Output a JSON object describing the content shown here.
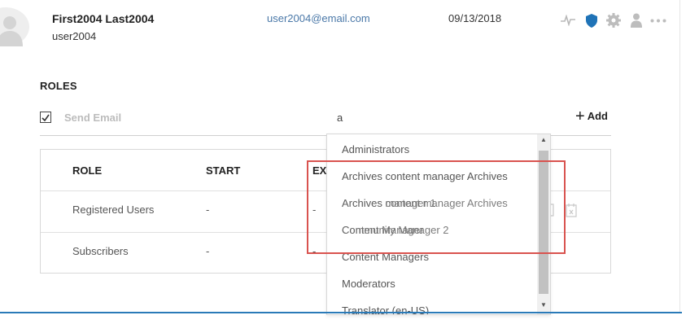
{
  "user": {
    "full_name": "First2004 Last2004",
    "username": "user2004",
    "email": "user2004@email.com",
    "date": "09/13/2018"
  },
  "header_icons": [
    "activity-icon",
    "shield-icon",
    "gear-icon",
    "person-icon",
    "more-icon"
  ],
  "colors": {
    "accent": "#2a7ab8",
    "link": "#4a78a8",
    "highlight": "#d9534f"
  },
  "roles": {
    "heading": "ROLES",
    "send_email_label": "Send Email",
    "send_email_checked": true,
    "search_value": "a",
    "add_label": "Add",
    "columns": [
      "ROLE",
      "START",
      "EX"
    ],
    "rows": [
      {
        "role": "Registered Users",
        "start": "-",
        "expires": "-"
      },
      {
        "role": "Subscribers",
        "start": "-",
        "expires": "-"
      }
    ]
  },
  "dropdown": {
    "items": [
      "Administrators",
      "Archives content manager Archives",
      "Archives content manager Archives",
      "Content Manager",
      "Content Managers",
      "Moderators",
      "Translator (en-US)"
    ],
    "overlay_items": [
      "Archives manager 1",
      "Community Manager 2"
    ]
  }
}
